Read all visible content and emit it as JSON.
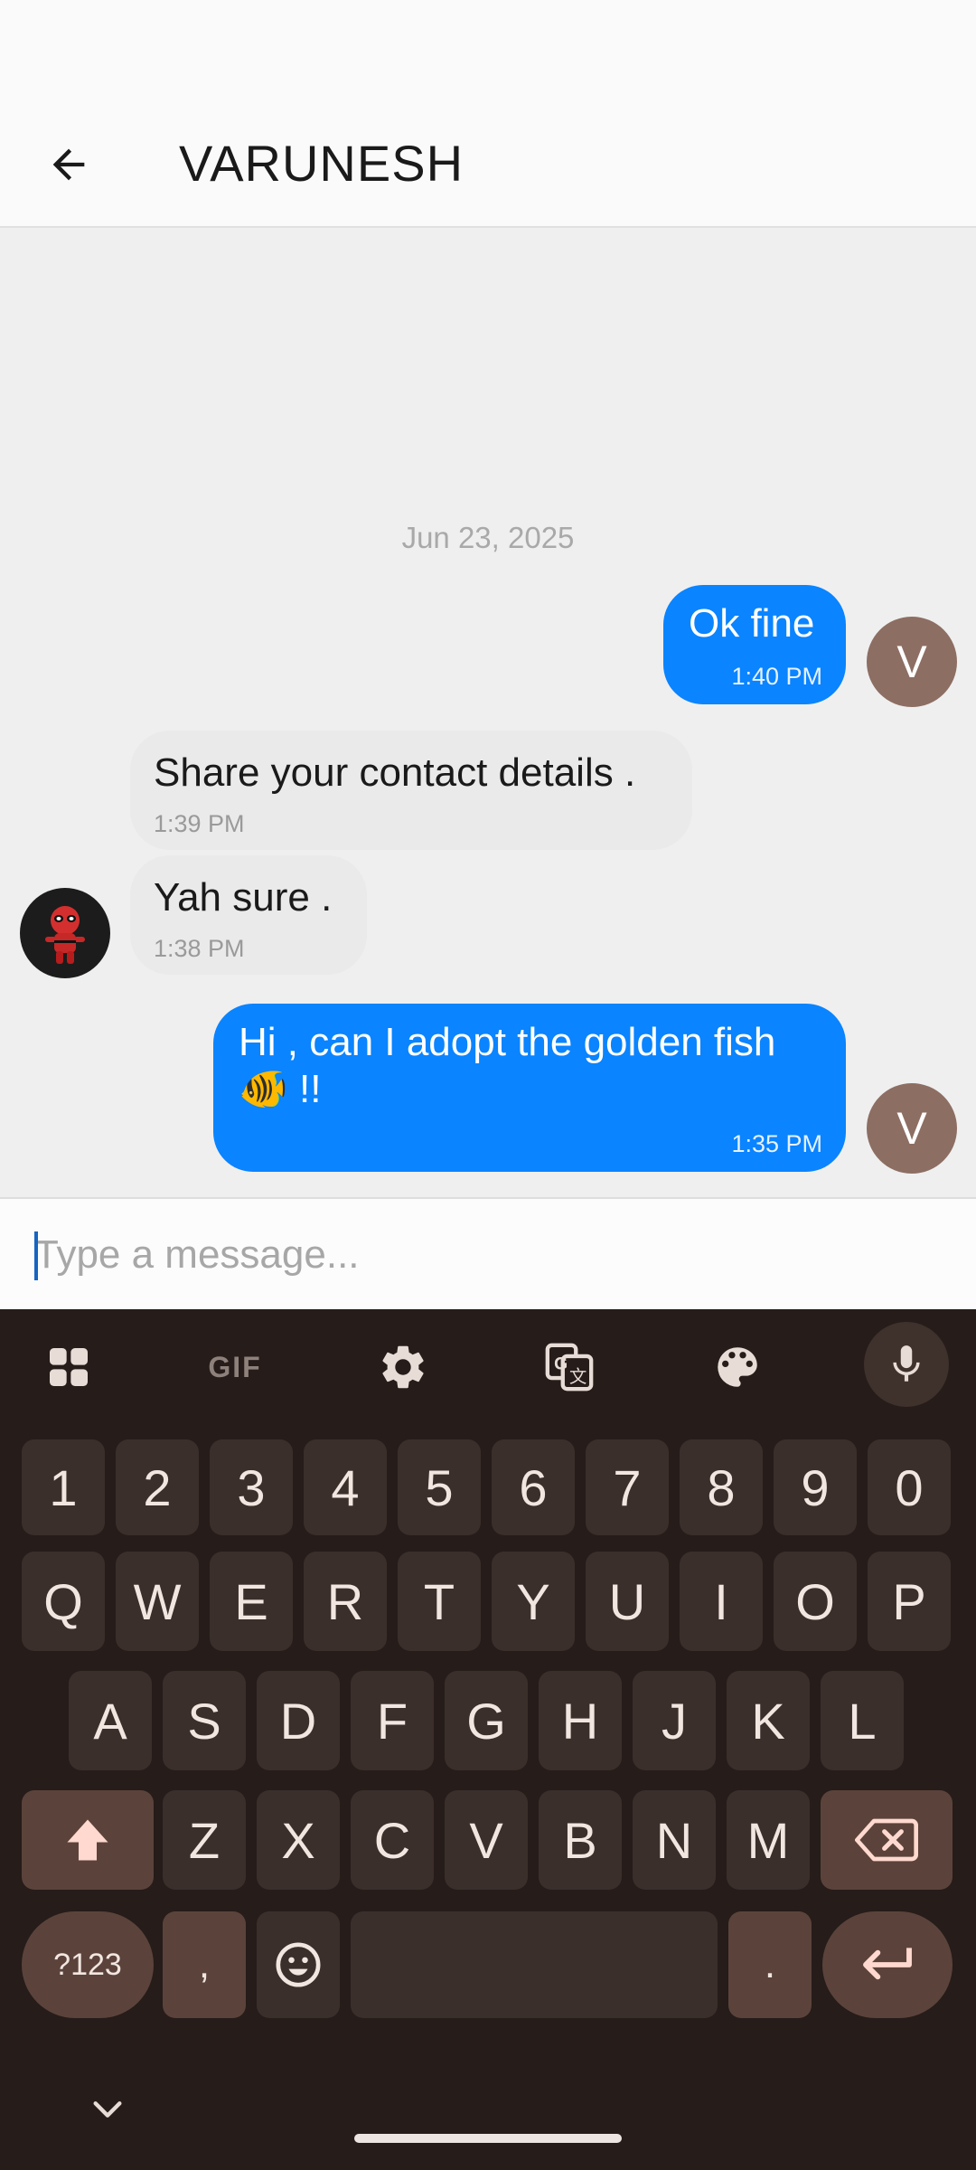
{
  "app_bar": {
    "title": "VARUNESH"
  },
  "chat": {
    "date": "Jun 23, 2025",
    "messages": [
      {
        "direction": "outgoing",
        "text": "Ok fine",
        "time": "1:40 PM",
        "avatar_letter": "V"
      },
      {
        "direction": "incoming",
        "text": "Share your contact details .",
        "time": "1:39 PM"
      },
      {
        "direction": "incoming",
        "text": "Yah sure .",
        "time": "1:38 PM"
      },
      {
        "direction": "outgoing",
        "text_line1": "Hi , can I adopt the golden fish",
        "text_line2": "🐠 !!",
        "time": "1:35 PM",
        "avatar_letter": "V"
      }
    ]
  },
  "composer": {
    "placeholder": "Type a message..."
  },
  "keyboard": {
    "toolbar": [
      "apps-icon",
      "gif-icon",
      "settings-icon",
      "translate-icon",
      "palette-icon",
      "mic-icon"
    ],
    "gif_label": "GIF",
    "number_row": [
      "1",
      "2",
      "3",
      "4",
      "5",
      "6",
      "7",
      "8",
      "9",
      "0"
    ],
    "row1": [
      "Q",
      "W",
      "E",
      "R",
      "T",
      "Y",
      "U",
      "I",
      "O",
      "P"
    ],
    "row2": [
      "A",
      "S",
      "D",
      "F",
      "G",
      "H",
      "J",
      "K",
      "L"
    ],
    "row3": [
      "Z",
      "X",
      "C",
      "V",
      "B",
      "N",
      "M"
    ],
    "symbols_label": "?123",
    "comma": ",",
    "period": "."
  },
  "colors": {
    "outgoing_bubble": "#0a84ff",
    "incoming_bubble": "#eaeaea",
    "avatar": "#8d6e63",
    "keyboard_bg": "#261c19",
    "key_bg": "#3b2f2b",
    "special_key_bg": "#5b433b"
  }
}
